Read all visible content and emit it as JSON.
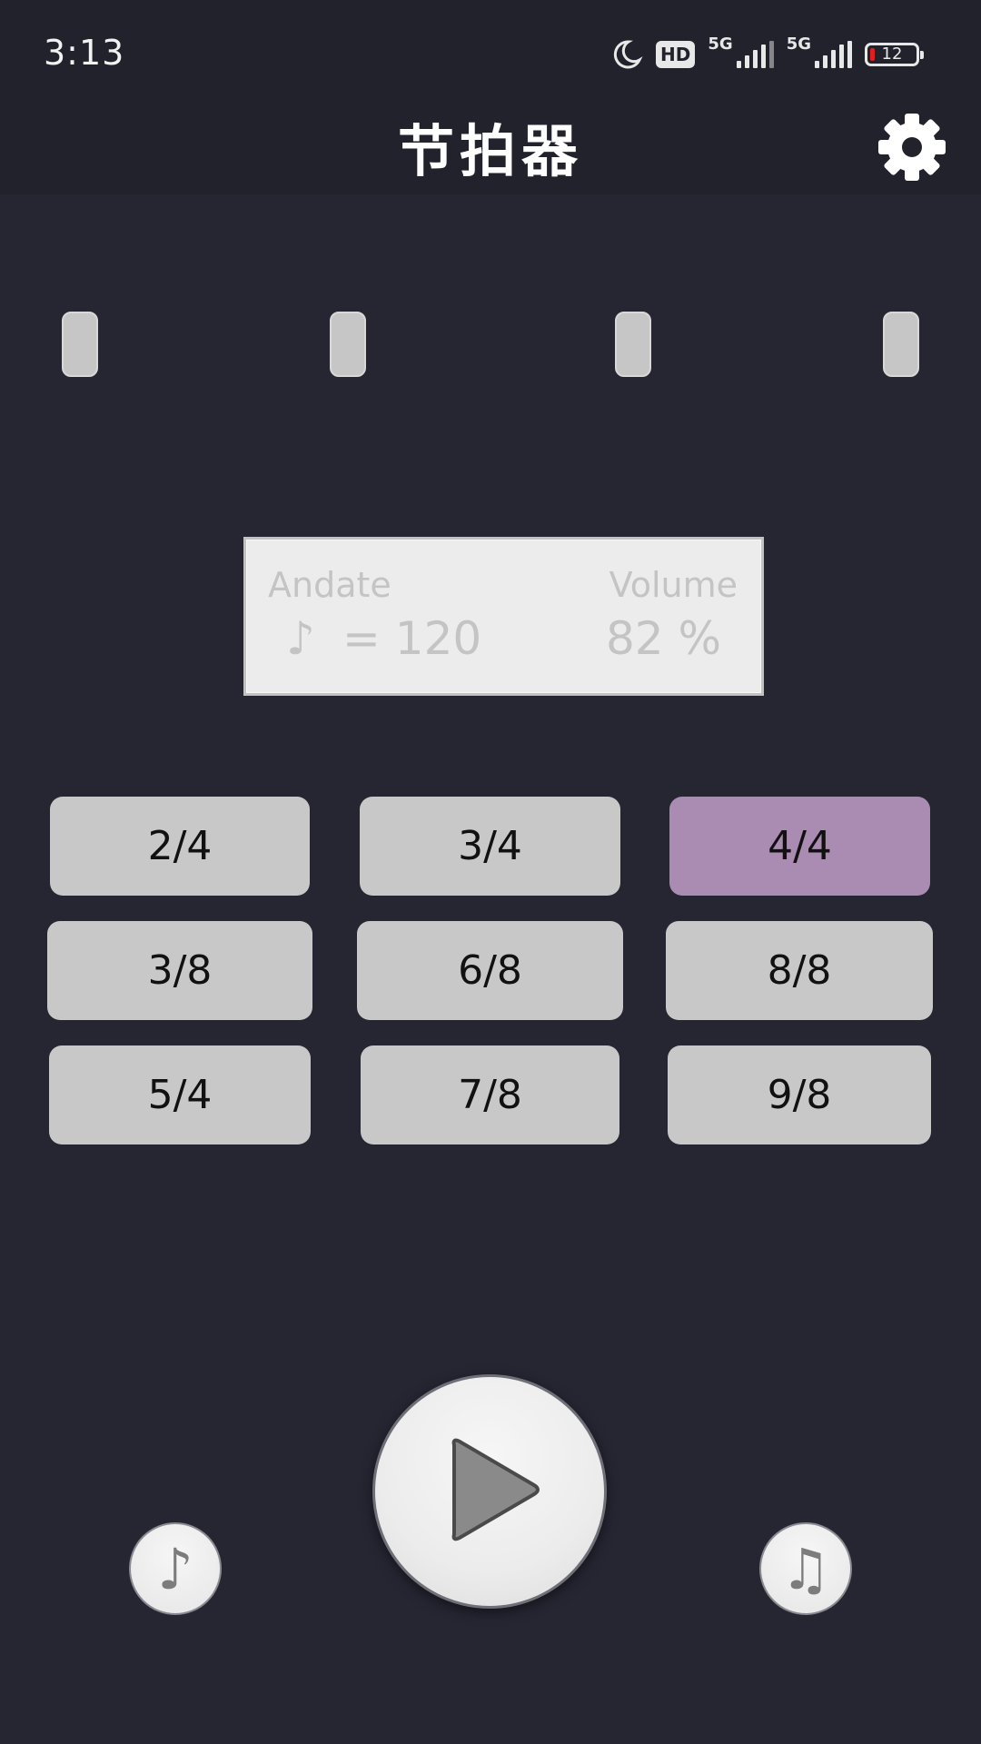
{
  "status_bar": {
    "time": "3:13",
    "hd_label": "HD",
    "network_1": "5G",
    "network_2": "5G",
    "battery": "12"
  },
  "header": {
    "title": "节拍器",
    "settings_icon": "gear-icon"
  },
  "beats": {
    "count": 4
  },
  "tempo_panel": {
    "tempo_name": "Andate",
    "note_symbol": "♪",
    "bpm_text": "= 120",
    "volume_label": "Volume",
    "volume_value": "82 %"
  },
  "time_signatures": [
    {
      "label": "2/4",
      "selected": false
    },
    {
      "label": "3/4",
      "selected": false
    },
    {
      "label": "4/4",
      "selected": true
    },
    {
      "label": "3/8",
      "selected": false
    },
    {
      "label": "6/8",
      "selected": false
    },
    {
      "label": "8/8",
      "selected": false
    },
    {
      "label": "5/4",
      "selected": false
    },
    {
      "label": "7/8",
      "selected": false
    },
    {
      "label": "9/8",
      "selected": false
    }
  ],
  "controls": {
    "left_icon": "eighth-note-icon",
    "left_glyph": "♪",
    "play_icon": "play-icon",
    "right_icon": "beamed-notes-icon",
    "right_glyph": "♫"
  },
  "colors": {
    "background": "#262633",
    "bar": "#22222d",
    "selected": "#aa8bb2",
    "button": "#c8c8c8"
  }
}
